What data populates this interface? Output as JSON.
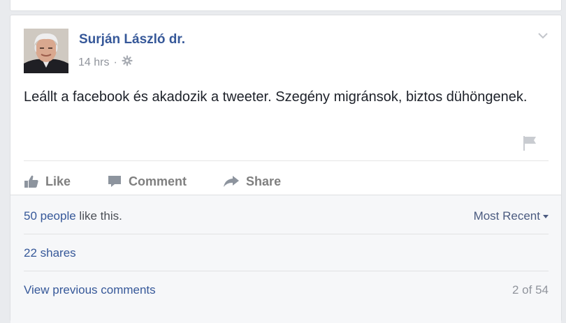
{
  "post": {
    "author": "Surján László dr.",
    "timestamp": "14 hrs",
    "separator": "·",
    "audience_icon": "gear-icon",
    "text": "Leállt a facebook és akadozik a tweeter. Szegény migránsok, biztos dühöngenek."
  },
  "actions": {
    "like": "Like",
    "comment": "Comment",
    "share": "Share"
  },
  "ufi": {
    "likes_count_link": "50 people",
    "likes_suffix": " like this.",
    "sort_label": "Most Recent",
    "shares": "22 shares",
    "view_previous": "View previous comments",
    "pager": "2 of 54"
  },
  "colors": {
    "link": "#365899",
    "text": "#1d2129",
    "muted": "#90949c",
    "action": "#7f7f7f",
    "ufi_bg": "#f6f7f9",
    "page_bg": "#e9ebee"
  }
}
